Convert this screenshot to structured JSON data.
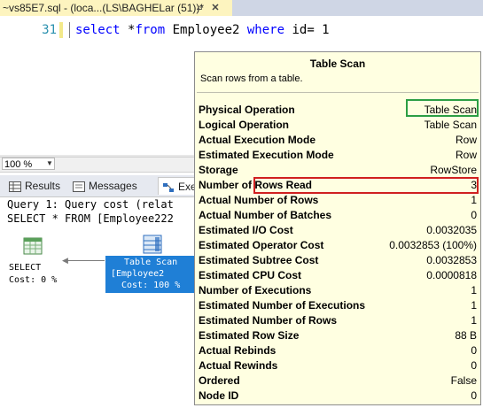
{
  "tab": {
    "title": "~vs85E7.sql - (loca...(LS\\BAGHELar (51))*"
  },
  "editor": {
    "line_number": "31",
    "code": {
      "kw_select": "select",
      "middle": " *",
      "kw_from": "from",
      "table": " Employee2 ",
      "kw_where": "where",
      "cond": " id= 1"
    }
  },
  "zoom": {
    "value": "100 %"
  },
  "results_tabs": {
    "results": "Results",
    "messages": "Messages",
    "execution": "Executio"
  },
  "query": {
    "line1": "Query 1: Query cost (relat",
    "line2": "SELECT * FROM [Employee222"
  },
  "plan": {
    "select_label": "SELECT",
    "select_cost": "Cost: 0 %",
    "ts_label1": "Table Scan",
    "ts_label2": "[Employee2",
    "ts_label3": "Cost: 100 %"
  },
  "tooltip": {
    "title": "Table Scan",
    "description": "Scan rows from a table.",
    "rows": [
      {
        "label": "Physical Operation",
        "value": "Table Scan"
      },
      {
        "label": "Logical Operation",
        "value": "Table Scan"
      },
      {
        "label": "Actual Execution Mode",
        "value": "Row"
      },
      {
        "label": "Estimated Execution Mode",
        "value": "Row"
      },
      {
        "label": "Storage",
        "value": "RowStore"
      },
      {
        "label": "Number of Rows Read",
        "value": "3"
      },
      {
        "label": "Actual Number of Rows",
        "value": "1"
      },
      {
        "label": "Actual Number of Batches",
        "value": "0"
      },
      {
        "label": "Estimated I/O Cost",
        "value": "0.0032035"
      },
      {
        "label": "Estimated Operator Cost",
        "value": "0.0032853 (100%)"
      },
      {
        "label": "Estimated Subtree Cost",
        "value": "0.0032853"
      },
      {
        "label": "Estimated CPU Cost",
        "value": "0.0000818"
      },
      {
        "label": "Number of Executions",
        "value": "1"
      },
      {
        "label": "Estimated Number of Executions",
        "value": "1"
      },
      {
        "label": "Estimated Number of Rows",
        "value": "1"
      },
      {
        "label": "Estimated Row Size",
        "value": "88 B"
      },
      {
        "label": "Actual Rebinds",
        "value": "0"
      },
      {
        "label": "Actual Rewinds",
        "value": "0"
      },
      {
        "label": "Ordered",
        "value": "False"
      },
      {
        "label": "Node ID",
        "value": "0"
      }
    ]
  },
  "colors": {
    "highlight_green": "#2c9e44",
    "highlight_red": "#d02020",
    "plan_node_selected": "#1f7fd6",
    "tooltip_bg": "#ffffe1"
  }
}
